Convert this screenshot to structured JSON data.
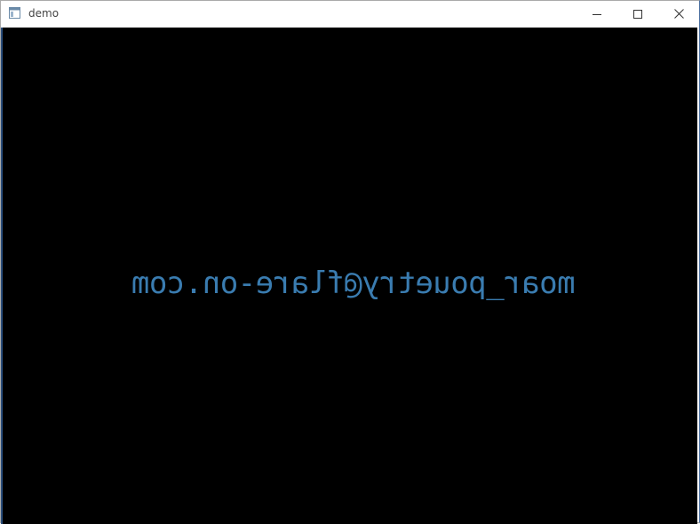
{
  "window": {
    "title": "demo",
    "app_icon": "window-app-icon",
    "controls": {
      "minimize_icon": "minimize-icon",
      "maximize_icon": "maximize-icon",
      "close_icon": "close-icon"
    }
  },
  "canvas": {
    "background_color": "#000000",
    "text": "moar_pouetry@flare-on.com",
    "text_color": "#3a7cb0",
    "text_rendering": "mirrored horizontally"
  }
}
